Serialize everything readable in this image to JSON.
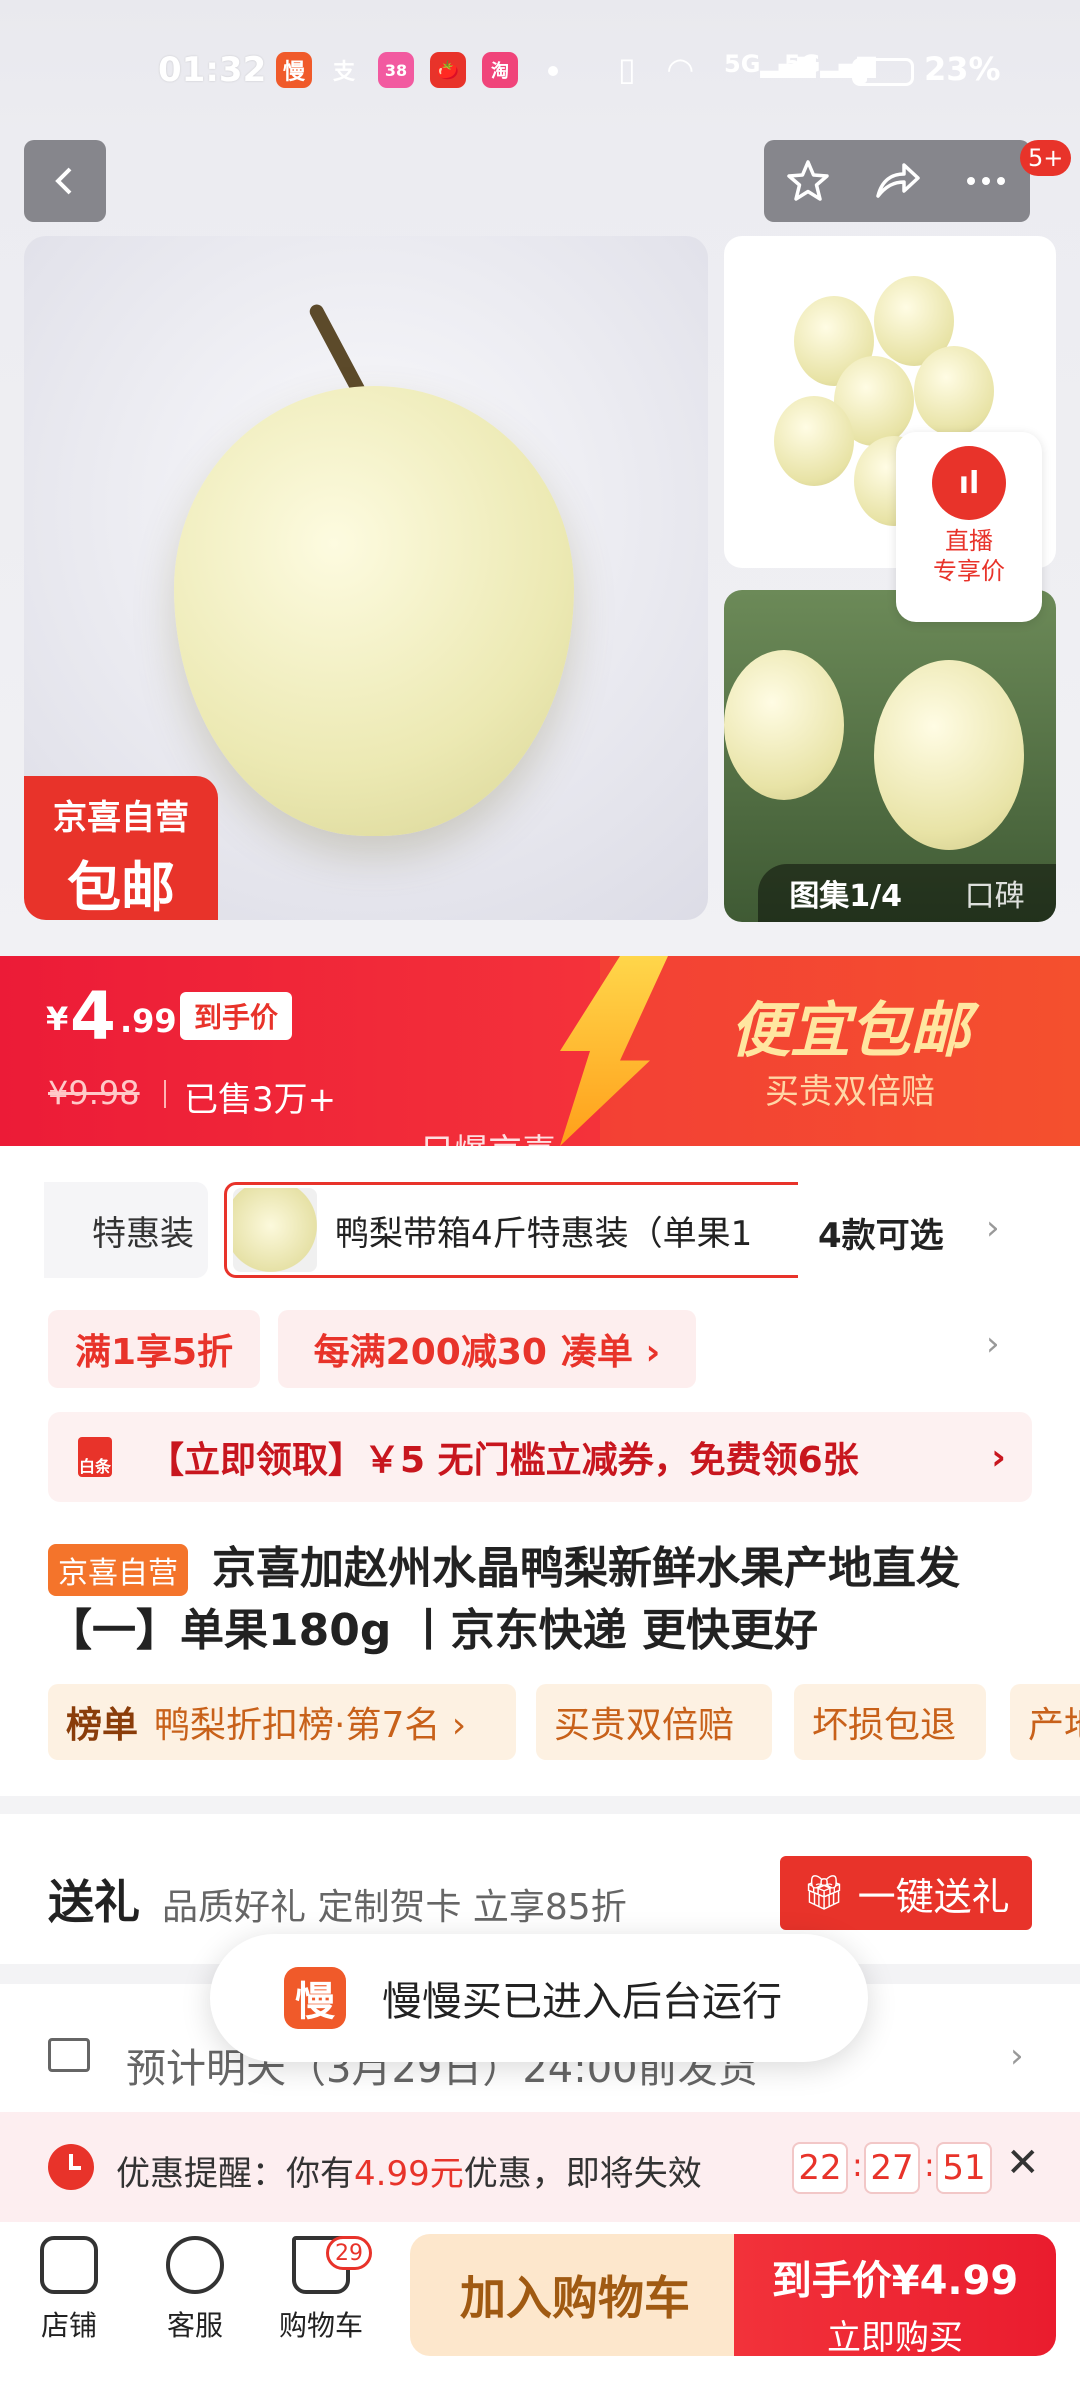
{
  "status_bar": {
    "time": "01:32",
    "battery": "23%",
    "apps": [
      "慢",
      "支",
      "38",
      "🍅",
      "淘"
    ]
  },
  "nav": {
    "badge": "5+"
  },
  "gallery": {
    "badge_line1": "京喜自营",
    "badge_line2": "包邮",
    "live_line1": "直播",
    "live_line2": "专享价",
    "album_label": "图集1/4",
    "review_label": "口碑"
  },
  "price": {
    "currency": "¥",
    "integer": "4",
    "decimal": ".99",
    "tag": "到手价",
    "original": "¥9.98",
    "sold": "已售3万+",
    "promo_title": "便宜包邮",
    "promo_sub": "买贵双倍赔",
    "overlay_text": "只爆京喜"
  },
  "sku": {
    "prev_option": "特惠装",
    "selected": "鸭梨带箱4斤特惠装（单果1",
    "more": "4款可选"
  },
  "coupons": {
    "c1": "满1享5折",
    "c2": "每满200减30",
    "c2_link": "凑单"
  },
  "voucher": {
    "icon_text": "白条",
    "text": "【立即领取】￥5 无门槛立减券，免费领6张"
  },
  "product": {
    "tag": "京喜自营",
    "title": "京喜加赵州水晶鸭梨新鲜水果产地直发【一】单果180g 丨京东快递 更快更好"
  },
  "chips": [
    {
      "label": "榜单",
      "text": "鸭梨折扣榜·第7名 ›"
    },
    {
      "text": "买贵双倍赔"
    },
    {
      "text": "坏损包退"
    },
    {
      "text": "产地"
    }
  ],
  "gift": {
    "title": "送礼",
    "desc": "品质好礼 定制贺卡 立享85折",
    "button": "一键送礼"
  },
  "shipping": {
    "text": "预计明天（3月29日）24:00前发货"
  },
  "toast": {
    "icon_text": "慢",
    "text": "慢慢买已进入后台运行"
  },
  "reminder": {
    "text_a": "优惠提醒：你有",
    "amount": "4.99元",
    "text_b": "优惠，即将失效",
    "hh": "22",
    "mm": "27",
    "ss": "51"
  },
  "bottom": {
    "shop": "店铺",
    "service": "客服",
    "cart": "购物车",
    "cart_count": "29",
    "add_cart": "加入购物车",
    "buy_price": "到手价¥4.99",
    "buy_now": "立即购买"
  },
  "colors": {
    "brand_red": "#e8332a",
    "promo_gold": "#ffe6a0"
  }
}
